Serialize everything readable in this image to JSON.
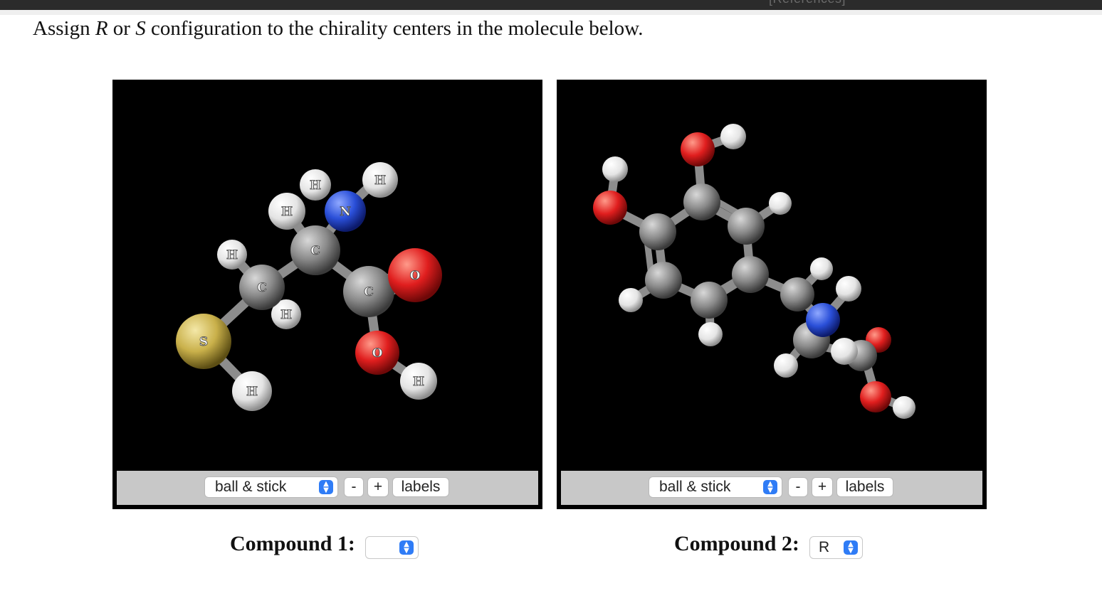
{
  "header": {
    "references_label": "[References]"
  },
  "question": {
    "prefix": "Assign ",
    "r": "R",
    "middle": " or ",
    "s": "S",
    "suffix": " configuration to the chirality centers in the molecule below."
  },
  "viewers": [
    {
      "display_mode": "ball & stick",
      "minus_label": "-",
      "plus_label": "+",
      "labels_label": "labels"
    },
    {
      "display_mode": "ball & stick",
      "minus_label": "-",
      "plus_label": "+",
      "labels_label": "labels"
    }
  ],
  "atom_labels": {
    "H": "H",
    "C": "C",
    "N": "N",
    "O": "O",
    "S": "S"
  },
  "compounds": [
    {
      "label": "Compound 1:",
      "value": ""
    },
    {
      "label": "Compound 2:",
      "value": "R"
    }
  ],
  "colors": {
    "carbon": "#8a8a8a",
    "hydrogen": "#f2f2f2",
    "nitrogen": "#2a4fd8",
    "oxygen": "#e01e1e",
    "sulfur": "#c9b04a",
    "select_accent": "#2f7cf6"
  }
}
